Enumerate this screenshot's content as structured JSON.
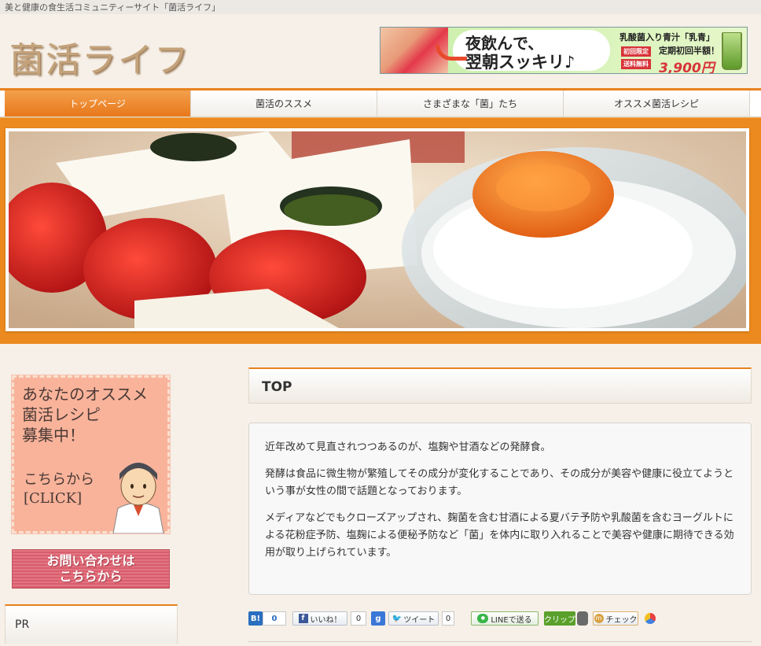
{
  "site": {
    "tagline": "美と健康の食生活コミュニティーサイト「菌活ライフ」",
    "logo": "菌活ライフ"
  },
  "ad_banner": {
    "headline_1": "夜飲んで、",
    "headline_2": "翌朝スッキリ♪",
    "product": "乳酸菌入り青汁「乳青」",
    "badge_1": "初回限定",
    "badge_2": "送料無料",
    "offer": "定期初回半額！",
    "price": "3,900円"
  },
  "nav": {
    "items": [
      {
        "label": "トップページ",
        "active": true
      },
      {
        "label": "菌活のススメ",
        "active": false
      },
      {
        "label": "さまざまな「菌」たち",
        "active": false
      },
      {
        "label": "オススメ菌活レシピ",
        "active": false
      }
    ]
  },
  "sidebar": {
    "recipe_banner": {
      "line_1": "あなたのオススメ",
      "line_2": "菌活レシピ",
      "line_3": "募集中！",
      "cta_1": "こちらから",
      "cta_2": "[CLICK]"
    },
    "contact_line_1": "お問い合わせは",
    "contact_line_2": "こちらから",
    "pr_title": "PR"
  },
  "main": {
    "title": "TOP",
    "paragraphs": [
      "近年改めて見直されつつあるのが、塩麹や甘酒などの発酵食。",
      "発酵は食品に微生物が繁殖してその成分が変化することであり、その成分が美容や健康に役立てようという事が女性の間で話題となっております。",
      "メディアなどでもクローズアップされ、麹菌を含む甘酒による夏バテ予防や乳酸菌を含むヨーグルトによる花粉症予防、塩麹による便秘予防など「菌」を体内に取り入れることで美容や健康に期待できる効用が取り上げられています。"
    ]
  },
  "social": {
    "hatena_label": "B!",
    "hatena_count": "0",
    "like_label": "いいね！",
    "like_count": "0",
    "gplus_label": "g",
    "tweet_label": "ツイート",
    "tweet_count": "0",
    "line_label": "LINEで送る",
    "clip_label": "クリップ",
    "check_label": "チェック"
  },
  "colors": {
    "accent_orange": "#e8821e",
    "background": "#f6f0e8",
    "contact_pink": "#e37582",
    "price_red": "#d8333a"
  }
}
